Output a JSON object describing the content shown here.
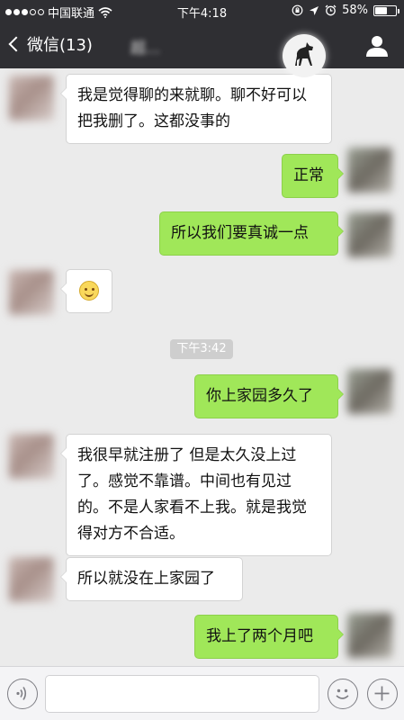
{
  "status_bar": {
    "carrier": "中国联通",
    "time": "下午4:18",
    "battery": "58%",
    "battery_level": 0.58
  },
  "nav": {
    "back_label": "微信(13)",
    "title": "超..."
  },
  "messages": [
    {
      "id": "m1",
      "side": "in",
      "text": "我是觉得聊的来就聊。聊不好可以把我删了。这都没事的"
    },
    {
      "id": "m2",
      "side": "out",
      "text": "正常"
    },
    {
      "id": "m3",
      "side": "out",
      "text": "所以我们要真诚一点"
    },
    {
      "id": "m4",
      "side": "in",
      "emoji": "smiley-icon"
    },
    {
      "id": "m5",
      "side": "out",
      "text": "你上家园多久了"
    },
    {
      "id": "m6",
      "side": "in",
      "text": "我很早就注册了 但是太久没上过了。感觉不靠谱。中间也有见过的。不是人家看不上我。就是我觉得对方不合适。"
    },
    {
      "id": "m7",
      "side": "in",
      "text": "所以就没在上家园了"
    },
    {
      "id": "m8",
      "side": "out",
      "text": "我上了两个月吧"
    }
  ],
  "timestamp": "下午3:42",
  "input_bar": {
    "value": "",
    "voice_icon": "voice-icon",
    "emoji_icon": "emoji-icon",
    "plus_icon": "plus-icon"
  },
  "colors": {
    "header": "#2f2f33",
    "background": "#ebebeb",
    "outgoing_bubble": "#a0e759",
    "incoming_bubble": "#ffffff"
  }
}
